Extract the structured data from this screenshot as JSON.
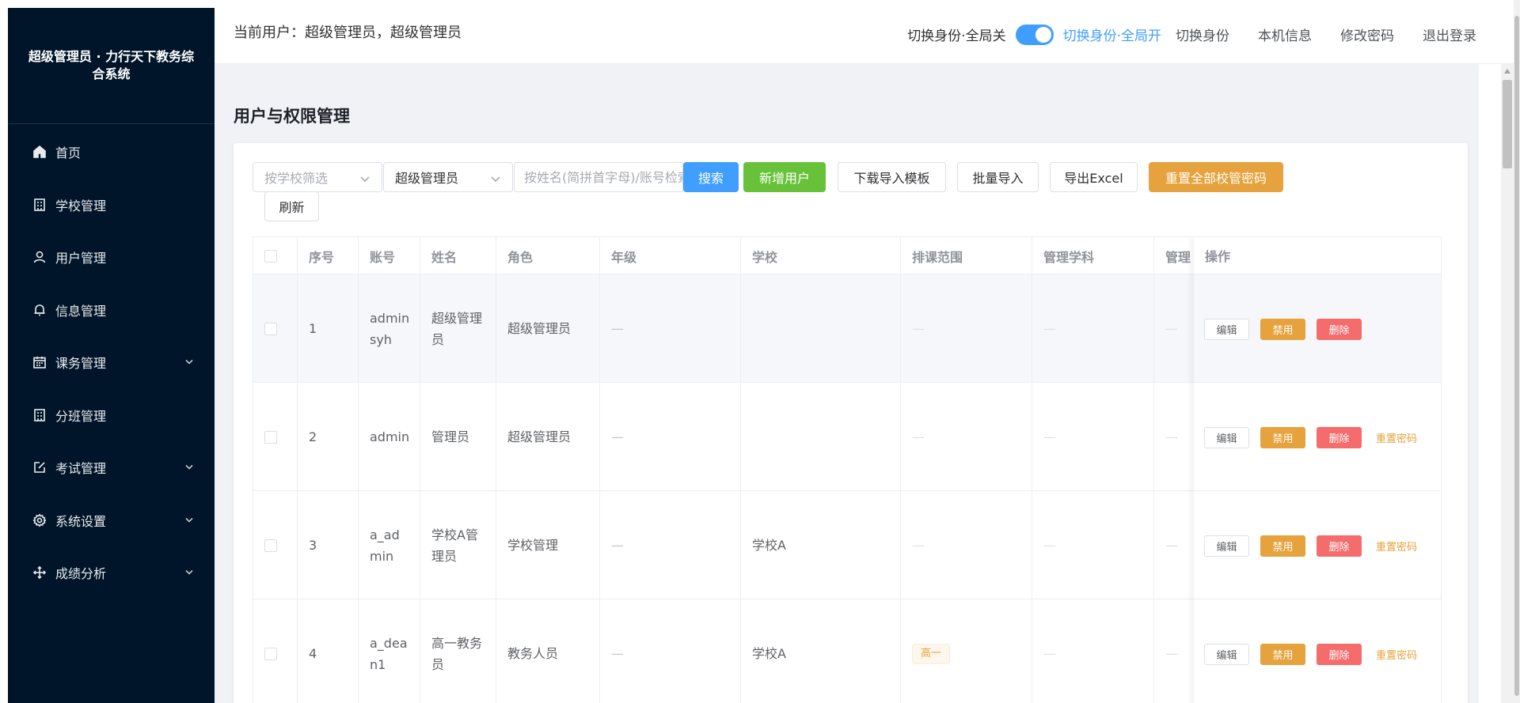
{
  "sidebar": {
    "logo": "超级管理员 · 力行天下教务综合系统",
    "items": [
      {
        "label": "首页",
        "icon": "home-icon",
        "expandable": false
      },
      {
        "label": "学校管理",
        "icon": "building-icon",
        "expandable": false
      },
      {
        "label": "用户管理",
        "icon": "user-icon",
        "expandable": false
      },
      {
        "label": "信息管理",
        "icon": "bell-icon",
        "expandable": false
      },
      {
        "label": "课务管理",
        "icon": "calendar-icon",
        "expandable": true
      },
      {
        "label": "分班管理",
        "icon": "building-icon",
        "expandable": false
      },
      {
        "label": "考试管理",
        "icon": "edit-icon",
        "expandable": true
      },
      {
        "label": "系统设置",
        "icon": "gear-icon",
        "expandable": true
      },
      {
        "label": "成绩分析",
        "icon": "move-icon",
        "expandable": true
      }
    ]
  },
  "header": {
    "current_user": "当前用户：超级管理员，超级管理员",
    "switch_off_label": "切换身份·全局关",
    "switch_on_label": "切换身份·全局开",
    "links": [
      "切换身份",
      "本机信息",
      "修改密码",
      "退出登录"
    ]
  },
  "page": {
    "title": "用户与权限管理"
  },
  "toolbar": {
    "school_filter_placeholder": "按学校筛选",
    "role_filter_value": "超级管理员",
    "search_placeholder": "按姓名(简拼首字母)/账号检索",
    "search_label": "搜索",
    "add_user_label": "新增用户",
    "download_template_label": "下载导入模板",
    "batch_import_label": "批量导入",
    "export_label": "导出Excel",
    "reset_all_label": "重置全部校管密码",
    "refresh_label": "刷新"
  },
  "table": {
    "columns": [
      "序号",
      "账号",
      "姓名",
      "角色",
      "年级",
      "学校",
      "排课范围",
      "管理学科",
      "管理",
      "操作"
    ],
    "rows": [
      {
        "index": "1",
        "account": "adminsyh",
        "name": "超级管理员",
        "role": "超级管理员",
        "grade": "—",
        "school": "",
        "range": "—",
        "subject": "—",
        "manage": "—",
        "range_tag": "",
        "can_reset": false
      },
      {
        "index": "2",
        "account": "admin",
        "name": "管理员",
        "role": "超级管理员",
        "grade": "—",
        "school": "",
        "range": "—",
        "subject": "—",
        "manage": "—",
        "range_tag": "",
        "can_reset": true
      },
      {
        "index": "3",
        "account": "a_admin",
        "name": "学校A管理员",
        "role": "学校管理",
        "grade": "—",
        "school": "学校A",
        "range": "—",
        "subject": "—",
        "manage": "—",
        "range_tag": "",
        "can_reset": true
      },
      {
        "index": "4",
        "account": "a_dean1",
        "name": "高一教务员",
        "role": "教务人员",
        "grade": "—",
        "school": "学校A",
        "range": "",
        "subject": "—",
        "manage": "—",
        "range_tag": "高一",
        "can_reset": true
      }
    ],
    "actions": {
      "edit": "编辑",
      "disable": "禁用",
      "delete": "删除",
      "reset": "重置密码"
    }
  },
  "colors": {
    "sidebar_bg": "#001529",
    "primary": "#409eff",
    "success": "#67c23a",
    "warning": "#e6a23c",
    "danger": "#f56c6c"
  }
}
